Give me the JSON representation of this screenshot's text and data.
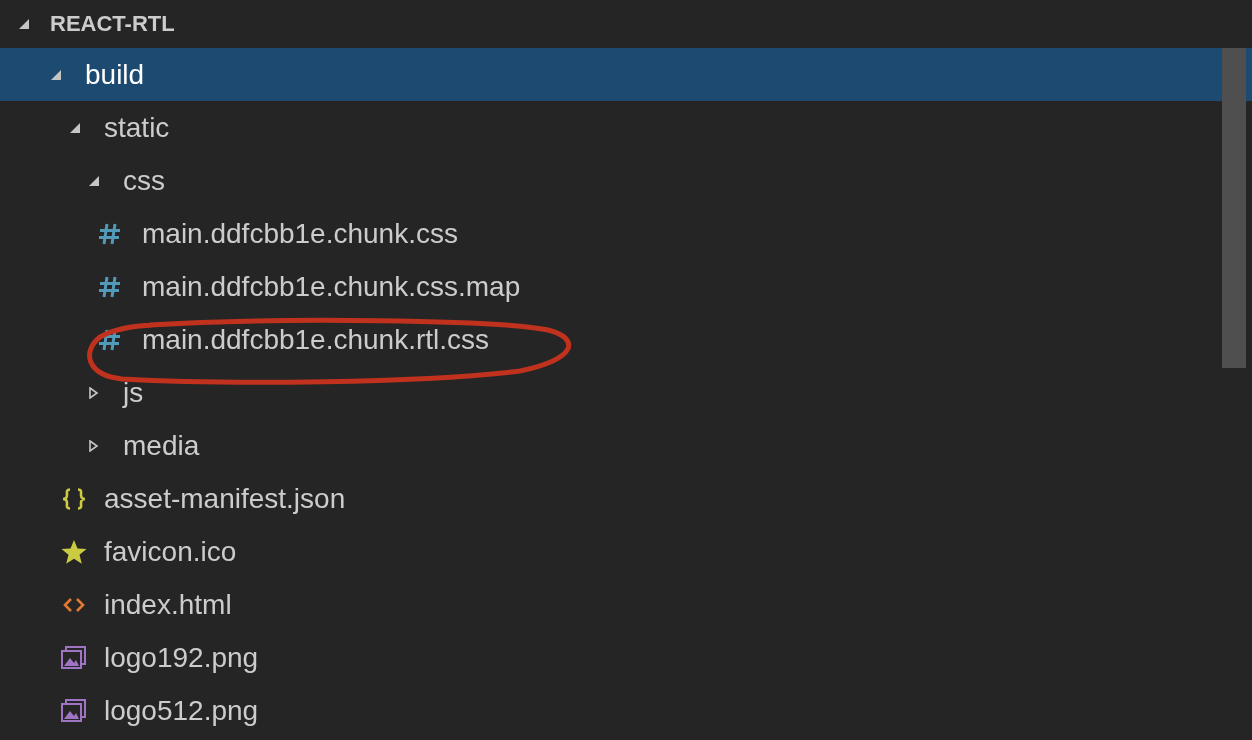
{
  "explorer": {
    "title": "REACT-RTL",
    "expanded": true,
    "tree": [
      {
        "name": "build",
        "kind": "folder",
        "expanded": true,
        "selected": true,
        "circled": false,
        "children": [
          {
            "name": "static",
            "kind": "folder",
            "expanded": true,
            "selected": false,
            "circled": false,
            "children": [
              {
                "name": "css",
                "kind": "folder",
                "expanded": true,
                "selected": false,
                "circled": false,
                "children": [
                  {
                    "name": "main.ddfcbb1e.chunk.css",
                    "kind": "css",
                    "selected": false,
                    "circled": false
                  },
                  {
                    "name": "main.ddfcbb1e.chunk.css.map",
                    "kind": "css",
                    "selected": false,
                    "circled": false
                  },
                  {
                    "name": "main.ddfcbb1e.chunk.rtl.css",
                    "kind": "css",
                    "selected": false,
                    "circled": true
                  }
                ]
              },
              {
                "name": "js",
                "kind": "folder",
                "expanded": false,
                "selected": false,
                "circled": false
              },
              {
                "name": "media",
                "kind": "folder",
                "expanded": false,
                "selected": false,
                "circled": false
              }
            ]
          },
          {
            "name": "asset-manifest.json",
            "kind": "json",
            "selected": false,
            "circled": false
          },
          {
            "name": "favicon.ico",
            "kind": "favicon",
            "selected": false,
            "circled": false
          },
          {
            "name": "index.html",
            "kind": "html",
            "selected": false,
            "circled": false
          },
          {
            "name": "logo192.png",
            "kind": "image",
            "selected": false,
            "circled": false
          },
          {
            "name": "logo512.png",
            "kind": "image",
            "selected": false,
            "circled": false
          }
        ]
      }
    ]
  }
}
